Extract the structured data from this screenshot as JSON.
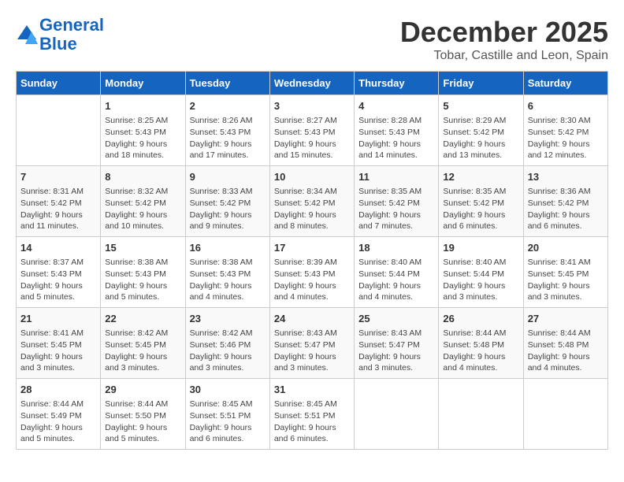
{
  "logo": {
    "line1": "General",
    "line2": "Blue"
  },
  "title": "December 2025",
  "subtitle": "Tobar, Castille and Leon, Spain",
  "weekdays": [
    "Sunday",
    "Monday",
    "Tuesday",
    "Wednesday",
    "Thursday",
    "Friday",
    "Saturday"
  ],
  "weeks": [
    [
      {
        "day": "",
        "info": ""
      },
      {
        "day": "1",
        "info": "Sunrise: 8:25 AM\nSunset: 5:43 PM\nDaylight: 9 hours\nand 18 minutes."
      },
      {
        "day": "2",
        "info": "Sunrise: 8:26 AM\nSunset: 5:43 PM\nDaylight: 9 hours\nand 17 minutes."
      },
      {
        "day": "3",
        "info": "Sunrise: 8:27 AM\nSunset: 5:43 PM\nDaylight: 9 hours\nand 15 minutes."
      },
      {
        "day": "4",
        "info": "Sunrise: 8:28 AM\nSunset: 5:43 PM\nDaylight: 9 hours\nand 14 minutes."
      },
      {
        "day": "5",
        "info": "Sunrise: 8:29 AM\nSunset: 5:42 PM\nDaylight: 9 hours\nand 13 minutes."
      },
      {
        "day": "6",
        "info": "Sunrise: 8:30 AM\nSunset: 5:42 PM\nDaylight: 9 hours\nand 12 minutes."
      }
    ],
    [
      {
        "day": "7",
        "info": "Sunrise: 8:31 AM\nSunset: 5:42 PM\nDaylight: 9 hours\nand 11 minutes."
      },
      {
        "day": "8",
        "info": "Sunrise: 8:32 AM\nSunset: 5:42 PM\nDaylight: 9 hours\nand 10 minutes."
      },
      {
        "day": "9",
        "info": "Sunrise: 8:33 AM\nSunset: 5:42 PM\nDaylight: 9 hours\nand 9 minutes."
      },
      {
        "day": "10",
        "info": "Sunrise: 8:34 AM\nSunset: 5:42 PM\nDaylight: 9 hours\nand 8 minutes."
      },
      {
        "day": "11",
        "info": "Sunrise: 8:35 AM\nSunset: 5:42 PM\nDaylight: 9 hours\nand 7 minutes."
      },
      {
        "day": "12",
        "info": "Sunrise: 8:35 AM\nSunset: 5:42 PM\nDaylight: 9 hours\nand 6 minutes."
      },
      {
        "day": "13",
        "info": "Sunrise: 8:36 AM\nSunset: 5:42 PM\nDaylight: 9 hours\nand 6 minutes."
      }
    ],
    [
      {
        "day": "14",
        "info": "Sunrise: 8:37 AM\nSunset: 5:43 PM\nDaylight: 9 hours\nand 5 minutes."
      },
      {
        "day": "15",
        "info": "Sunrise: 8:38 AM\nSunset: 5:43 PM\nDaylight: 9 hours\nand 5 minutes."
      },
      {
        "day": "16",
        "info": "Sunrise: 8:38 AM\nSunset: 5:43 PM\nDaylight: 9 hours\nand 4 minutes."
      },
      {
        "day": "17",
        "info": "Sunrise: 8:39 AM\nSunset: 5:43 PM\nDaylight: 9 hours\nand 4 minutes."
      },
      {
        "day": "18",
        "info": "Sunrise: 8:40 AM\nSunset: 5:44 PM\nDaylight: 9 hours\nand 4 minutes."
      },
      {
        "day": "19",
        "info": "Sunrise: 8:40 AM\nSunset: 5:44 PM\nDaylight: 9 hours\nand 3 minutes."
      },
      {
        "day": "20",
        "info": "Sunrise: 8:41 AM\nSunset: 5:45 PM\nDaylight: 9 hours\nand 3 minutes."
      }
    ],
    [
      {
        "day": "21",
        "info": "Sunrise: 8:41 AM\nSunset: 5:45 PM\nDaylight: 9 hours\nand 3 minutes."
      },
      {
        "day": "22",
        "info": "Sunrise: 8:42 AM\nSunset: 5:45 PM\nDaylight: 9 hours\nand 3 minutes."
      },
      {
        "day": "23",
        "info": "Sunrise: 8:42 AM\nSunset: 5:46 PM\nDaylight: 9 hours\nand 3 minutes."
      },
      {
        "day": "24",
        "info": "Sunrise: 8:43 AM\nSunset: 5:47 PM\nDaylight: 9 hours\nand 3 minutes."
      },
      {
        "day": "25",
        "info": "Sunrise: 8:43 AM\nSunset: 5:47 PM\nDaylight: 9 hours\nand 3 minutes."
      },
      {
        "day": "26",
        "info": "Sunrise: 8:44 AM\nSunset: 5:48 PM\nDaylight: 9 hours\nand 4 minutes."
      },
      {
        "day": "27",
        "info": "Sunrise: 8:44 AM\nSunset: 5:48 PM\nDaylight: 9 hours\nand 4 minutes."
      }
    ],
    [
      {
        "day": "28",
        "info": "Sunrise: 8:44 AM\nSunset: 5:49 PM\nDaylight: 9 hours\nand 5 minutes."
      },
      {
        "day": "29",
        "info": "Sunrise: 8:44 AM\nSunset: 5:50 PM\nDaylight: 9 hours\nand 5 minutes."
      },
      {
        "day": "30",
        "info": "Sunrise: 8:45 AM\nSunset: 5:51 PM\nDaylight: 9 hours\nand 6 minutes."
      },
      {
        "day": "31",
        "info": "Sunrise: 8:45 AM\nSunset: 5:51 PM\nDaylight: 9 hours\nand 6 minutes."
      },
      {
        "day": "",
        "info": ""
      },
      {
        "day": "",
        "info": ""
      },
      {
        "day": "",
        "info": ""
      }
    ]
  ]
}
